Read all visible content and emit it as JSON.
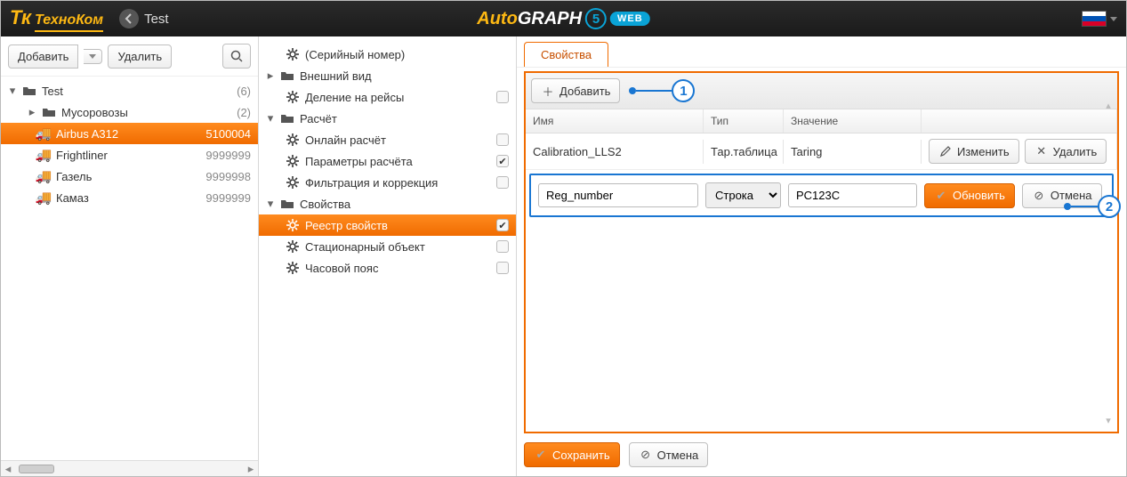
{
  "top": {
    "company": "ТехноКом",
    "back_label": "Test",
    "autograph_auto": "Auto",
    "autograph_graph": "GRAPH",
    "five": "5",
    "web": "WEB"
  },
  "left": {
    "add": "Добавить",
    "delete": "Удалить",
    "tree": [
      {
        "type": "folder",
        "label": "Test",
        "meta": "(6)",
        "lvl": 1,
        "exp": "▾"
      },
      {
        "type": "folder",
        "label": "Мусоровозы",
        "meta": "(2)",
        "lvl": 2,
        "exp": "▸"
      },
      {
        "type": "car",
        "label": "Airbus A312",
        "meta": "5100004",
        "lvl": 3,
        "active": true
      },
      {
        "type": "car",
        "label": "Frightliner",
        "meta": "9999999",
        "lvl": 3
      },
      {
        "type": "car",
        "label": "Газель",
        "meta": "9999998",
        "lvl": 3
      },
      {
        "type": "car",
        "label": "Камаз",
        "meta": "9999999",
        "lvl": 3
      }
    ]
  },
  "mid": {
    "items": [
      {
        "icon": "gear",
        "label": "(Серийный номер)",
        "lvl": 2
      },
      {
        "icon": "folder",
        "label": "Внешний вид",
        "lvl": 1,
        "exp": "▸"
      },
      {
        "icon": "gear",
        "label": "Деление на рейсы",
        "lvl": 2,
        "check": false
      },
      {
        "icon": "folder",
        "label": "Расчёт",
        "lvl": 1,
        "exp": "▾"
      },
      {
        "icon": "gear",
        "label": "Онлайн расчёт",
        "lvl": 2,
        "check": false
      },
      {
        "icon": "gear",
        "label": "Параметры расчёта",
        "lvl": 2,
        "check": true
      },
      {
        "icon": "gear",
        "label": "Фильтрация и коррекция",
        "lvl": 2,
        "check": false
      },
      {
        "icon": "folder",
        "label": "Свойства",
        "lvl": 1,
        "exp": "▾"
      },
      {
        "icon": "gear",
        "label": "Реестр свойств",
        "lvl": 2,
        "check": true,
        "active": true
      },
      {
        "icon": "gear",
        "label": "Стационарный объект",
        "lvl": 2,
        "check": false
      },
      {
        "icon": "gear",
        "label": "Часовой пояс",
        "lvl": 2,
        "check": false
      }
    ]
  },
  "right": {
    "tab": "Свойства",
    "add": "Добавить",
    "cols": {
      "name": "Имя",
      "type": "Тип",
      "value": "Значение"
    },
    "row": {
      "name": "Calibration_LLS2",
      "type": "Тар.таблица",
      "value": "Taring",
      "edit": "Изменить",
      "del": "Удалить"
    },
    "edit": {
      "name": "Reg_number",
      "type": "Строка",
      "value": "PC123C",
      "update": "Обновить",
      "cancel": "Отмена"
    },
    "footer": {
      "save": "Сохранить",
      "cancel": "Отмена"
    },
    "callouts": {
      "one": "1",
      "two": "2"
    }
  }
}
